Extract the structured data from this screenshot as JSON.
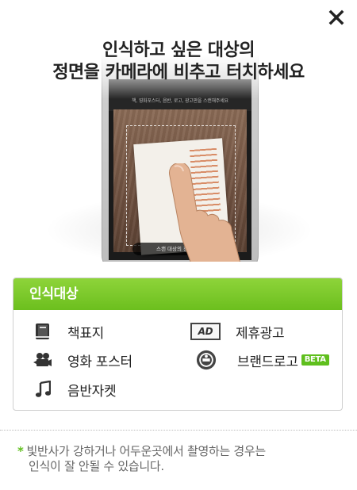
{
  "close": {
    "icon": "close-icon"
  },
  "headline": {
    "line1": "인식하고 싶은 대상의",
    "line2": "정면을 카메라에 비추고 터치하세요"
  },
  "phone_screen": {
    "guide_text": "책, 영화포스터, 음반, 로고, 광고판을 스캔해주세요",
    "caption": "스캔 대상의 정면을 비"
  },
  "panel": {
    "title": "인식대상",
    "items": [
      {
        "label": "책표지",
        "icon": "book-icon"
      },
      {
        "label": "영화 포스터",
        "icon": "movie-camera-icon"
      },
      {
        "label": "음반자켓",
        "icon": "music-note-icon"
      },
      {
        "label": "제휴광고",
        "icon": "ad-icon",
        "icon_text": "AD"
      },
      {
        "label": "브랜드로고",
        "icon": "brand-logo-icon",
        "badge": "BETA"
      }
    ]
  },
  "note": {
    "star": "*",
    "line1": "빛반사가 강하거나 어두운곳에서 촬영하는 경우는",
    "line2": "인식이 잘 안될 수 있습니다."
  },
  "colors": {
    "accent_green": "#6cbf1e",
    "text": "#222222",
    "note_text": "#666666"
  }
}
